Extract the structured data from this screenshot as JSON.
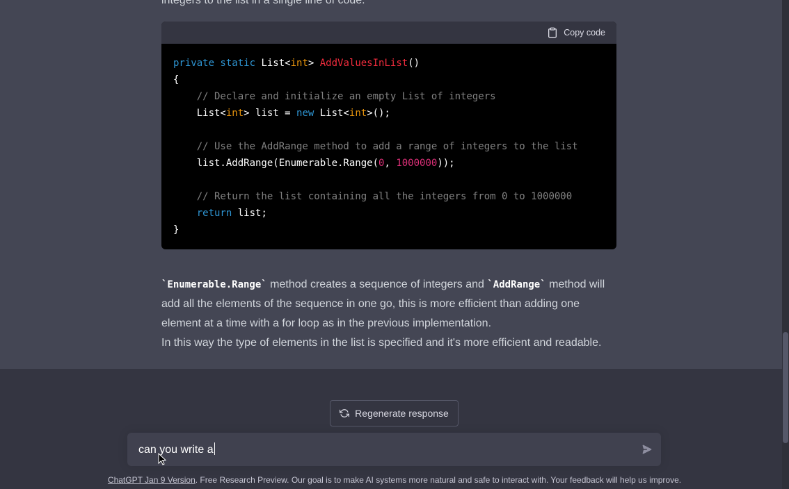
{
  "conversation": {
    "previous_line": "integers to the list in a single line of code.",
    "code_block": {
      "copy_label": "Copy code",
      "lines": [
        [
          {
            "t": "private static ",
            "c": "kw"
          },
          {
            "t": "List<",
            "c": ""
          },
          {
            "t": "int",
            "c": "ty"
          },
          {
            "t": "> ",
            "c": ""
          },
          {
            "t": "AddValuesInList",
            "c": "fn"
          },
          {
            "t": "()",
            "c": ""
          }
        ],
        [
          {
            "t": "{",
            "c": ""
          }
        ],
        [
          {
            "t": "    // Declare and initialize an empty List of integers",
            "c": "cm"
          }
        ],
        [
          {
            "t": "    List<",
            "c": ""
          },
          {
            "t": "int",
            "c": "ty"
          },
          {
            "t": "> list = ",
            "c": ""
          },
          {
            "t": "new ",
            "c": "kw"
          },
          {
            "t": "List<",
            "c": ""
          },
          {
            "t": "int",
            "c": "ty"
          },
          {
            "t": ">();",
            "c": ""
          }
        ],
        [
          {
            "t": "",
            "c": ""
          }
        ],
        [
          {
            "t": "    // Use the AddRange method to add a range of integers to the list",
            "c": "cm"
          }
        ],
        [
          {
            "t": "    list.AddRange(Enumerable.Range(",
            "c": ""
          },
          {
            "t": "0",
            "c": "nm"
          },
          {
            "t": ", ",
            "c": ""
          },
          {
            "t": "1000000",
            "c": "nm"
          },
          {
            "t": "));",
            "c": ""
          }
        ],
        [
          {
            "t": "",
            "c": ""
          }
        ],
        [
          {
            "t": "    // Return the list containing all the integers from 0 to 1000000",
            "c": "cm"
          }
        ],
        [
          {
            "t": "    ",
            "c": ""
          },
          {
            "t": "return",
            "c": "kw"
          },
          {
            "t": " list;",
            "c": ""
          }
        ],
        [
          {
            "t": "}",
            "c": ""
          }
        ]
      ]
    },
    "explanation": {
      "code1": "`Enumerable.Range`",
      "text1": " method creates a sequence of integers and ",
      "code2": "`AddRange`",
      "text2": " method will add all the elements of the sequence in one go, this is more efficient than adding one element at a time with a for loop as in the previous implementation.",
      "line2": "In this way the type of elements in the list is specified and it's more efficient and readable."
    }
  },
  "regenerate_label": "Regenerate response",
  "input": {
    "value": "can you write a"
  },
  "footer": {
    "link_text": "ChatGPT Jan 9 Version",
    "text": ". Free Research Preview. Our goal is to make AI systems more natural and safe to interact with. Your feedback will help us improve."
  },
  "icons": {
    "copy": "clipboard-icon",
    "regenerate": "refresh-icon",
    "send": "paper-plane-icon"
  },
  "colors": {
    "chat_bg": "#444654",
    "page_bg": "#343541",
    "code_bg": "#000000",
    "input_bg": "#40414f"
  }
}
